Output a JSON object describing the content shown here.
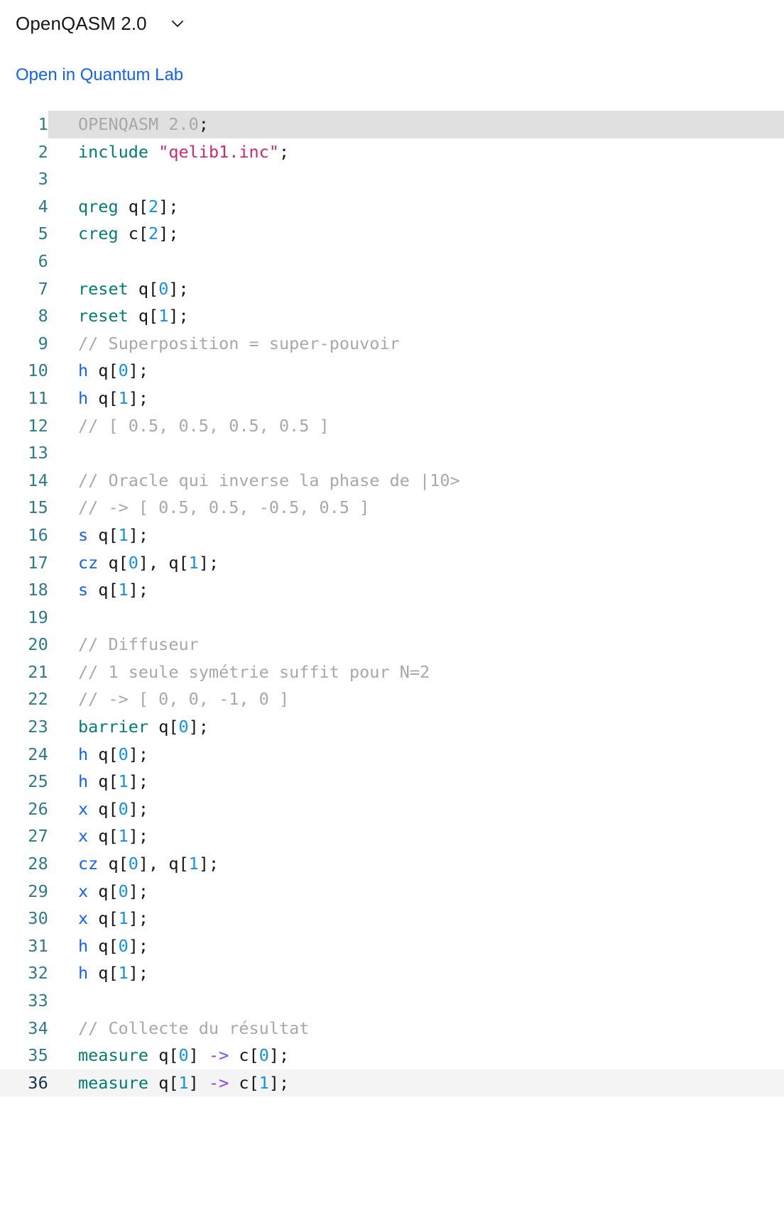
{
  "header": {
    "title": "OpenQASM 2.0",
    "dropdown_icon": "chevron-down-icon"
  },
  "actions": {
    "open_lab_label": "Open in Quantum Lab"
  },
  "editor": {
    "language": "OpenQASM 2.0",
    "active_line": 36,
    "highlighted_line": 1,
    "total_lines": 36,
    "colors": {
      "keyword": "#007d79",
      "gate": "#0f62fe",
      "number": "#1192e8",
      "string": "#d12771",
      "comment": "#a8a8a8",
      "arrow": "#8a3ffc",
      "plain": "#161616",
      "line_number": "#2b7b8c",
      "active_line_number": "#16334f",
      "active_line_bg": "#f4f4f4",
      "highlight_bg": "#e0e0e0",
      "link": "#0f62fe"
    },
    "lines": [
      {
        "n": "1",
        "highlight": true,
        "tokens": [
          {
            "t": "OPENQASM 2.0",
            "c": "magic"
          },
          {
            "t": ";",
            "c": "plain"
          }
        ]
      },
      {
        "n": "2",
        "tokens": [
          {
            "t": "include",
            "c": "kw"
          },
          {
            "t": " ",
            "c": "plain"
          },
          {
            "t": "\"qelib1.inc\"",
            "c": "str"
          },
          {
            "t": ";",
            "c": "plain"
          }
        ]
      },
      {
        "n": "3",
        "tokens": []
      },
      {
        "n": "4",
        "tokens": [
          {
            "t": "qreg",
            "c": "kw"
          },
          {
            "t": " q[",
            "c": "plain"
          },
          {
            "t": "2",
            "c": "num"
          },
          {
            "t": "];",
            "c": "plain"
          }
        ]
      },
      {
        "n": "5",
        "tokens": [
          {
            "t": "creg",
            "c": "kw"
          },
          {
            "t": " c[",
            "c": "plain"
          },
          {
            "t": "2",
            "c": "num"
          },
          {
            "t": "];",
            "c": "plain"
          }
        ]
      },
      {
        "n": "6",
        "tokens": []
      },
      {
        "n": "7",
        "tokens": [
          {
            "t": "reset",
            "c": "kw"
          },
          {
            "t": " q[",
            "c": "plain"
          },
          {
            "t": "0",
            "c": "num"
          },
          {
            "t": "];",
            "c": "plain"
          }
        ]
      },
      {
        "n": "8",
        "tokens": [
          {
            "t": "reset",
            "c": "kw"
          },
          {
            "t": " q[",
            "c": "plain"
          },
          {
            "t": "1",
            "c": "num"
          },
          {
            "t": "];",
            "c": "plain"
          }
        ]
      },
      {
        "n": "9",
        "tokens": [
          {
            "t": "// Superposition = super-pouvoir",
            "c": "comment"
          }
        ]
      },
      {
        "n": "10",
        "tokens": [
          {
            "t": "h",
            "c": "gate"
          },
          {
            "t": " q[",
            "c": "plain"
          },
          {
            "t": "0",
            "c": "num"
          },
          {
            "t": "];",
            "c": "plain"
          }
        ]
      },
      {
        "n": "11",
        "tokens": [
          {
            "t": "h",
            "c": "gate"
          },
          {
            "t": " q[",
            "c": "plain"
          },
          {
            "t": "1",
            "c": "num"
          },
          {
            "t": "];",
            "c": "plain"
          }
        ]
      },
      {
        "n": "12",
        "tokens": [
          {
            "t": "// [ 0.5, 0.5, 0.5, 0.5 ]",
            "c": "comment"
          }
        ]
      },
      {
        "n": "13",
        "tokens": []
      },
      {
        "n": "14",
        "tokens": [
          {
            "t": "// Oracle qui inverse la phase de |10>",
            "c": "comment"
          }
        ]
      },
      {
        "n": "15",
        "tokens": [
          {
            "t": "// -> [ 0.5, 0.5, -0.5, 0.5 ]",
            "c": "comment"
          }
        ]
      },
      {
        "n": "16",
        "tokens": [
          {
            "t": "s",
            "c": "gate"
          },
          {
            "t": " q[",
            "c": "plain"
          },
          {
            "t": "1",
            "c": "num"
          },
          {
            "t": "];",
            "c": "plain"
          }
        ]
      },
      {
        "n": "17",
        "tokens": [
          {
            "t": "cz",
            "c": "gate"
          },
          {
            "t": " q[",
            "c": "plain"
          },
          {
            "t": "0",
            "c": "num"
          },
          {
            "t": "], q[",
            "c": "plain"
          },
          {
            "t": "1",
            "c": "num"
          },
          {
            "t": "];",
            "c": "plain"
          }
        ]
      },
      {
        "n": "18",
        "tokens": [
          {
            "t": "s",
            "c": "gate"
          },
          {
            "t": " q[",
            "c": "plain"
          },
          {
            "t": "1",
            "c": "num"
          },
          {
            "t": "];",
            "c": "plain"
          }
        ]
      },
      {
        "n": "19",
        "tokens": []
      },
      {
        "n": "20",
        "tokens": [
          {
            "t": "// Diffuseur",
            "c": "comment"
          }
        ]
      },
      {
        "n": "21",
        "tokens": [
          {
            "t": "// 1 seule symétrie suffit pour N=2",
            "c": "comment"
          }
        ]
      },
      {
        "n": "22",
        "tokens": [
          {
            "t": "// -> [ 0, 0, -1, 0 ]",
            "c": "comment"
          }
        ]
      },
      {
        "n": "23",
        "tokens": [
          {
            "t": "barrier",
            "c": "kw"
          },
          {
            "t": " q[",
            "c": "plain"
          },
          {
            "t": "0",
            "c": "num"
          },
          {
            "t": "];",
            "c": "plain"
          }
        ]
      },
      {
        "n": "24",
        "tokens": [
          {
            "t": "h",
            "c": "gate"
          },
          {
            "t": " q[",
            "c": "plain"
          },
          {
            "t": "0",
            "c": "num"
          },
          {
            "t": "];",
            "c": "plain"
          }
        ]
      },
      {
        "n": "25",
        "tokens": [
          {
            "t": "h",
            "c": "gate"
          },
          {
            "t": " q[",
            "c": "plain"
          },
          {
            "t": "1",
            "c": "num"
          },
          {
            "t": "];",
            "c": "plain"
          }
        ]
      },
      {
        "n": "26",
        "tokens": [
          {
            "t": "x",
            "c": "gate"
          },
          {
            "t": " q[",
            "c": "plain"
          },
          {
            "t": "0",
            "c": "num"
          },
          {
            "t": "];",
            "c": "plain"
          }
        ]
      },
      {
        "n": "27",
        "tokens": [
          {
            "t": "x",
            "c": "gate"
          },
          {
            "t": " q[",
            "c": "plain"
          },
          {
            "t": "1",
            "c": "num"
          },
          {
            "t": "];",
            "c": "plain"
          }
        ]
      },
      {
        "n": "28",
        "tokens": [
          {
            "t": "cz",
            "c": "gate"
          },
          {
            "t": " q[",
            "c": "plain"
          },
          {
            "t": "0",
            "c": "num"
          },
          {
            "t": "], q[",
            "c": "plain"
          },
          {
            "t": "1",
            "c": "num"
          },
          {
            "t": "];",
            "c": "plain"
          }
        ]
      },
      {
        "n": "29",
        "tokens": [
          {
            "t": "x",
            "c": "gate"
          },
          {
            "t": " q[",
            "c": "plain"
          },
          {
            "t": "0",
            "c": "num"
          },
          {
            "t": "];",
            "c": "plain"
          }
        ]
      },
      {
        "n": "30",
        "tokens": [
          {
            "t": "x",
            "c": "gate"
          },
          {
            "t": " q[",
            "c": "plain"
          },
          {
            "t": "1",
            "c": "num"
          },
          {
            "t": "];",
            "c": "plain"
          }
        ]
      },
      {
        "n": "31",
        "tokens": [
          {
            "t": "h",
            "c": "gate"
          },
          {
            "t": " q[",
            "c": "plain"
          },
          {
            "t": "0",
            "c": "num"
          },
          {
            "t": "];",
            "c": "plain"
          }
        ]
      },
      {
        "n": "32",
        "tokens": [
          {
            "t": "h",
            "c": "gate"
          },
          {
            "t": " q[",
            "c": "plain"
          },
          {
            "t": "1",
            "c": "num"
          },
          {
            "t": "];",
            "c": "plain"
          }
        ]
      },
      {
        "n": "33",
        "tokens": []
      },
      {
        "n": "34",
        "tokens": [
          {
            "t": "// Collecte du résultat",
            "c": "comment"
          }
        ]
      },
      {
        "n": "35",
        "tokens": [
          {
            "t": "measure",
            "c": "kw"
          },
          {
            "t": " q[",
            "c": "plain"
          },
          {
            "t": "0",
            "c": "num"
          },
          {
            "t": "] ",
            "c": "plain"
          },
          {
            "t": "->",
            "c": "arrow"
          },
          {
            "t": " c[",
            "c": "plain"
          },
          {
            "t": "0",
            "c": "num"
          },
          {
            "t": "];",
            "c": "plain"
          }
        ]
      },
      {
        "n": "36",
        "active": true,
        "tokens": [
          {
            "t": "measure",
            "c": "kw"
          },
          {
            "t": " q[",
            "c": "plain"
          },
          {
            "t": "1",
            "c": "num"
          },
          {
            "t": "] ",
            "c": "plain"
          },
          {
            "t": "->",
            "c": "arrow"
          },
          {
            "t": " c[",
            "c": "plain"
          },
          {
            "t": "1",
            "c": "num"
          },
          {
            "t": "];",
            "c": "plain"
          }
        ]
      }
    ]
  }
}
